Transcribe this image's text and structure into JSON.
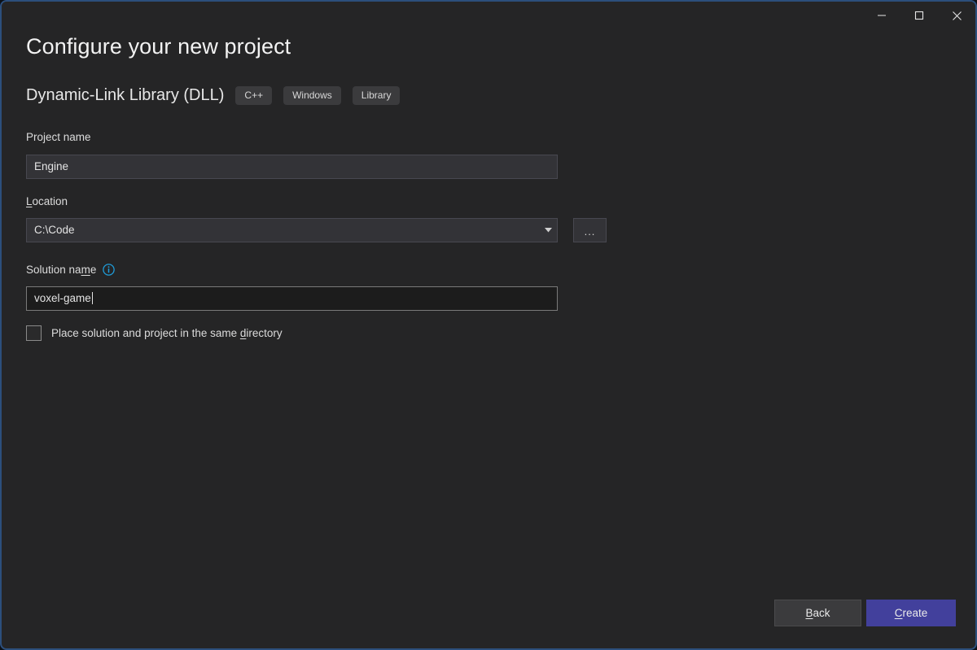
{
  "window": {
    "border_color": "#2c4f7c",
    "background": "#252526",
    "controls": [
      {
        "name": "minimize",
        "glyph": "minimize-icon"
      },
      {
        "name": "maximize",
        "glyph": "maximize-icon"
      },
      {
        "name": "close",
        "glyph": "close-icon"
      }
    ]
  },
  "header": {
    "title": "Configure your new project",
    "template_name": "Dynamic-Link Library (DLL)",
    "tags": [
      "C++",
      "Windows",
      "Library"
    ]
  },
  "form": {
    "project_name": {
      "label": "Project name",
      "value": "Engine",
      "placeholder": "",
      "focused": false
    },
    "location": {
      "label_prefix": "",
      "label_accel": "L",
      "label_suffix": "ocation",
      "value": "C:\\Code",
      "dropdown_icon": "chevron-down-icon",
      "browse_label": "...",
      "browse_tooltip": "Browse"
    },
    "solution_name": {
      "label_prefix": "Solution na",
      "label_accel": "m",
      "label_suffix": "e",
      "info_icon": "info-icon",
      "info_color": "#1f9cd9",
      "value": "voxel-game",
      "placeholder": "",
      "focused": true
    },
    "same_directory_checkbox": {
      "checked": false,
      "label_prefix": "Place solution and project in the same ",
      "label_accel": "d",
      "label_suffix": "irectory"
    }
  },
  "footer": {
    "back": {
      "label_prefix": "",
      "label_accel": "B",
      "label_suffix": "ack",
      "color": "#3b3b3d"
    },
    "create": {
      "label_prefix": "",
      "label_accel": "C",
      "label_suffix": "reate",
      "color": "#42409c"
    }
  }
}
